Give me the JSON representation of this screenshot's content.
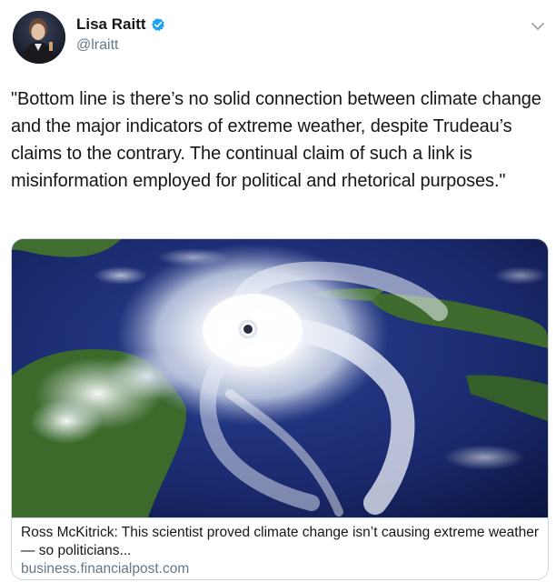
{
  "tweet": {
    "author": {
      "display_name": "Lisa Raitt",
      "handle": "@lraitt",
      "verified": true
    },
    "text": "\"Bottom line is there’s no solid connection between climate change and the major indicators of extreme weather, despite Trudeau’s claims to the contrary. The continual claim of such a link is misinformation employed for political and rhetorical purposes.\"",
    "card": {
      "image_alt": "satellite-hurricane-image",
      "title": "Ross McKitrick: This scientist proved climate change isn’t causing extreme weather — so politicians...",
      "domain": "business.financialpost.com"
    }
  },
  "colors": {
    "primary_text": "#14171a",
    "secondary_text": "#657786",
    "verified_blue": "#1da1f2",
    "card_border": "#ccd6dd"
  },
  "icons": {
    "verified": "verified-badge-icon",
    "more": "chevron-down-icon"
  }
}
